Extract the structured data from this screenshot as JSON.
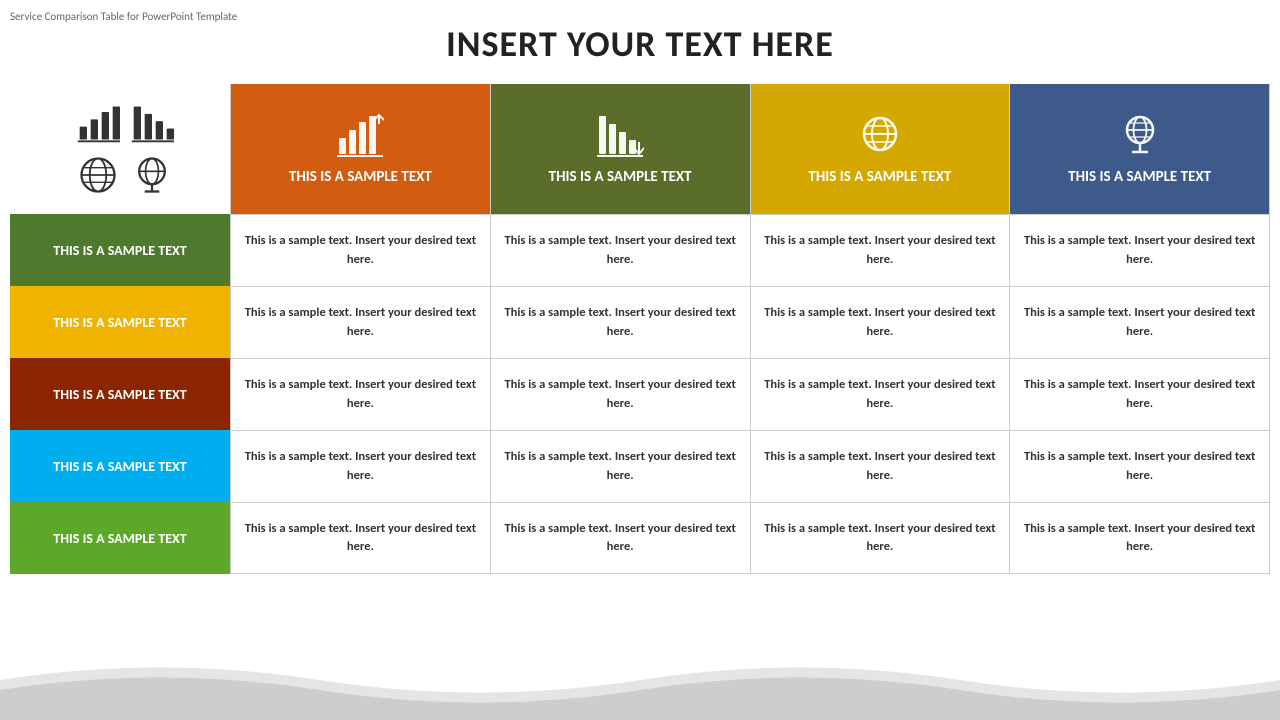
{
  "watermark": "Service Comparison Table for PowerPoint Template",
  "title": "INSERT YOUR TEXT HERE",
  "left_col": {
    "row_labels": [
      {
        "text": "THIS IS A SAMPLE TEXT",
        "color_class": "row-label-green"
      },
      {
        "text": "THIS IS A SAMPLE TEXT",
        "color_class": "row-label-yellow"
      },
      {
        "text": "THIS IS A SAMPLE TEXT",
        "color_class": "row-label-brown"
      },
      {
        "text": "THIS IS A SAMPLE TEXT",
        "color_class": "row-label-cyan"
      },
      {
        "text": "THIS IS A SAMPLE TEXT",
        "color_class": "row-label-lime"
      }
    ]
  },
  "columns": [
    {
      "header_text": "THIS IS A SAMPLE TEXT",
      "color_class": "col-header-orange",
      "icon": "bar-chart-up",
      "cells": [
        "This is a sample text. Insert your desired text here.",
        "This is a sample text. Insert your desired text here.",
        "This is a sample text. Insert your desired text here.",
        "This is a sample text. Insert your desired text here.",
        "This is a sample text. Insert your desired text here."
      ]
    },
    {
      "header_text": "THIS IS A SAMPLE TEXT",
      "color_class": "col-header-olive",
      "icon": "bar-chart-down",
      "cells": [
        "This is a sample text. Insert your desired text here.",
        "This is a sample text. Insert your desired text here.",
        "This is a sample text. Insert your desired text here.",
        "This is a sample text. Insert your desired text here.",
        "This is a sample text. Insert your desired text here."
      ]
    },
    {
      "header_text": "THIS IS A SAMPLE TEXT",
      "color_class": "col-header-gold",
      "icon": "globe",
      "cells": [
        "This is a sample text. Insert your desired text here.",
        "This is a sample text. Insert your desired text here.",
        "This is a sample text. Insert your desired text here.",
        "This is a sample text. Insert your desired text here.",
        "This is a sample text. Insert your desired text here."
      ]
    },
    {
      "header_text": "THIS IS A SAMPLE TEXT",
      "color_class": "col-header-blue",
      "icon": "globe-stand",
      "cells": [
        "This is a sample text. Insert your desired text here.",
        "This is a sample text. Insert your desired text here.",
        "This is a sample text. Insert your desired text here.",
        "This is a sample text. Insert your desired text here.",
        "This is a sample text. Insert your desired text here."
      ]
    }
  ]
}
